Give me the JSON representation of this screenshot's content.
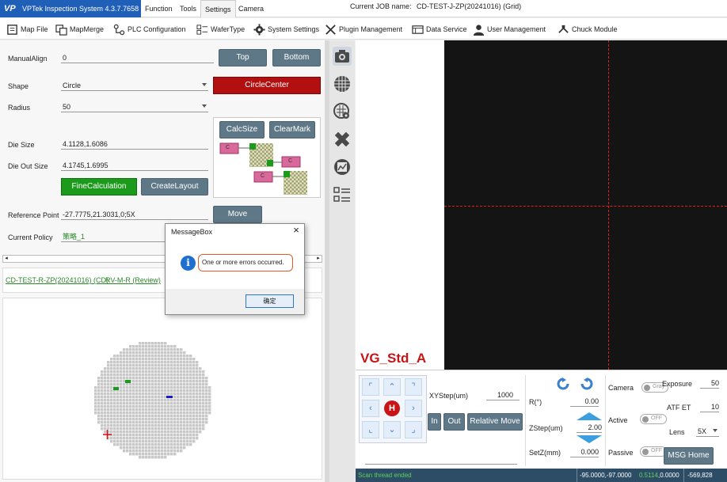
{
  "app": {
    "logo": "VP",
    "title": "VPTek Inspection System 4.3.7.7658",
    "menu": [
      "Function",
      "Tools",
      "Settings",
      "Camera"
    ],
    "active_menu": "Settings",
    "job_label": "Current JOB name:",
    "job_name": "CD-TEST-J-ZP(20241016) (Grid)"
  },
  "toolbar": {
    "items": [
      "Map File",
      "MapMerge",
      "PLC Configuration",
      "WaferType",
      "System Settings",
      "Plugin Management",
      "Data Service",
      "User Management",
      "Chuck Module"
    ]
  },
  "form": {
    "manual_align_label": "ManualAlign",
    "manual_align_value": "0",
    "top_btn": "Top",
    "bottom_btn": "Bottom",
    "shape_label": "Shape",
    "shape_value": "Circle",
    "circle_center_btn": "CircleCenter",
    "radius_label": "Radius",
    "radius_value": "50",
    "calc_size_btn": "CalcSize",
    "clear_mark_btn": "ClearMark",
    "die_size_label": "Die Size",
    "die_size_value": "4.1128,1.6086",
    "die_out_size_label": "Die Out Size",
    "die_out_size_value": "4.1745,1.6995",
    "fine_calc_btn": "FineCalculation",
    "create_layout_btn": "CreateLayout",
    "ref_point_label": "Reference Point",
    "ref_point_value": "-27.7775,21.3031,0;5X",
    "move_btn": "Move",
    "current_policy_label": "Current Policy",
    "current_policy_value": "策略_1",
    "diagram_marker": "C"
  },
  "links": {
    "cd": "CD-TEST-R-ZP(20241016) (CD)",
    "rv": "RV-M-R (Review)"
  },
  "camera": {
    "label": "VG_Std_A"
  },
  "controls": {
    "home_glyph": "H",
    "xy_step_label": "XYStep(um)",
    "xy_step_value": "1000",
    "in_btn": "In",
    "out_btn": "Out",
    "relative_move_btn": "Relative Move",
    "r_label": "R(°)",
    "r_value": "0.00",
    "zstep_label": "ZStep(um)",
    "zstep_value": "2.00",
    "setz_label": "SetZ(mm)",
    "setz_value": "0.000",
    "camera_label": "Camera",
    "camera_toggle": "Gray",
    "active_label": "Active",
    "active_toggle": "OFF",
    "passive_label": "Passive",
    "passive_toggle": "OFF",
    "exposure_label": "Exposure",
    "exposure_value": "50",
    "atf_label": "ATF ET",
    "atf_value": "10",
    "lens_label": "Lens",
    "lens_value": "5X",
    "msg_home_btn": "MSG Home"
  },
  "status": {
    "left": "Scan thread ended",
    "coord_a": "-95.0000,-97.0000",
    "coord_b": "0.5114",
    "coord_c": ",0.0000",
    "coord_d": "-569,828"
  },
  "dialog": {
    "title": "MessageBox",
    "close": "×",
    "message": "One or more errors occurred.",
    "ok": "确定"
  },
  "colors": {
    "brand": "#1f5fb8",
    "wafer_die": "#c8c8c8",
    "mark_green": "#1c9a1c",
    "mark_blue": "#1a1ac8",
    "crosshair": "#e02020"
  }
}
